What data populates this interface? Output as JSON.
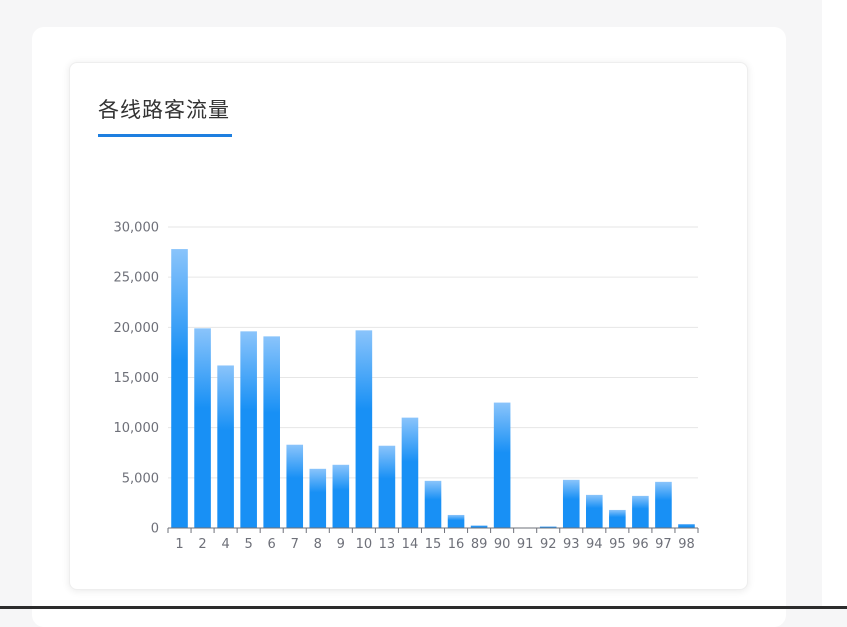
{
  "card": {
    "title": "各线路客流量"
  },
  "colors": {
    "bar_top": "#8ac4fb",
    "bar_bottom": "#1890f5",
    "accent": "#1e7fe0",
    "grid": "#e6e6e6",
    "axis": "#6e7079"
  },
  "chart_data": {
    "type": "bar",
    "title": "",
    "xlabel": "",
    "ylabel": "",
    "categories": [
      "1",
      "2",
      "4",
      "5",
      "6",
      "7",
      "8",
      "9",
      "10",
      "13",
      "14",
      "15",
      "16",
      "89",
      "90",
      "91",
      "92",
      "93",
      "94",
      "95",
      "96",
      "97",
      "98"
    ],
    "values": [
      27800,
      19900,
      16200,
      19600,
      19100,
      8300,
      5900,
      6300,
      19700,
      8200,
      11000,
      4700,
      1300,
      250,
      12500,
      50,
      150,
      4800,
      3300,
      1800,
      3200,
      4600,
      400
    ],
    "ylim": [
      0,
      30000
    ],
    "yticks": [
      0,
      5000,
      10000,
      15000,
      20000,
      25000,
      30000
    ],
    "ytick_labels": [
      "0",
      "5,000",
      "10,000",
      "15,000",
      "20,000",
      "25,000",
      "30,000"
    ],
    "grid": true,
    "legend": "none"
  }
}
